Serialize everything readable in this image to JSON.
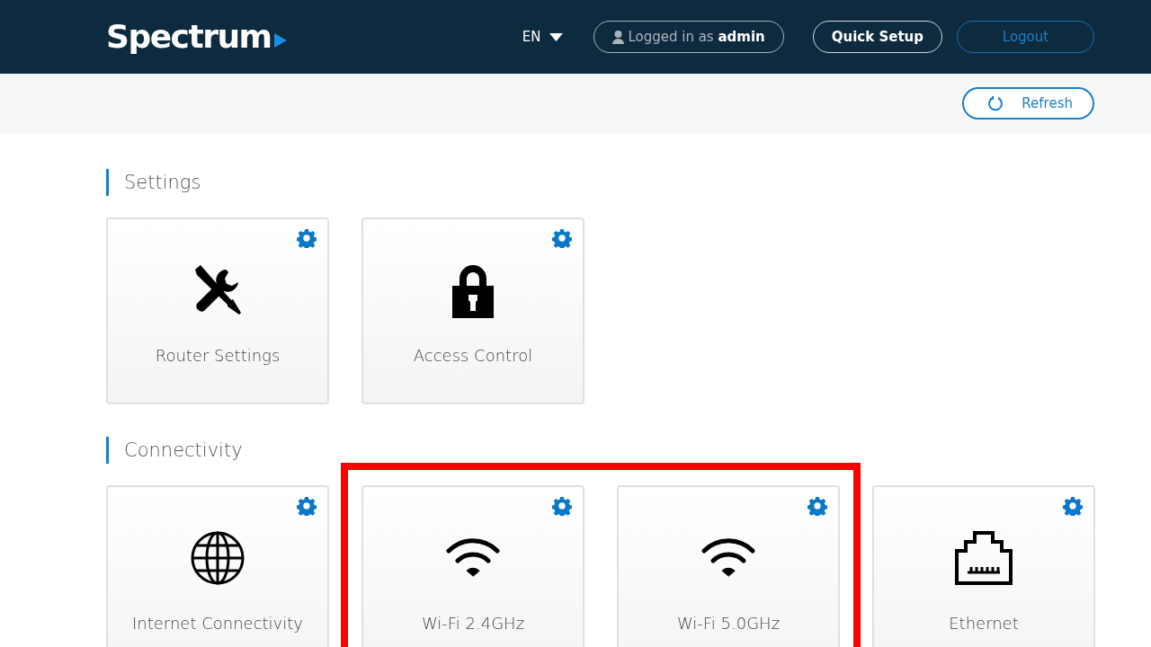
{
  "header": {
    "logo": "Spectrum",
    "language": "EN",
    "user": {
      "prefix": "Logged in as",
      "name": "admin"
    },
    "buttons": [
      {
        "label": "Quick Setup",
        "kind": "outline-white"
      },
      {
        "label": "Logout",
        "kind": "outline-blue"
      }
    ]
  },
  "toolbar": {
    "refresh": "Refresh"
  },
  "sections": [
    {
      "title": "Settings",
      "tiles": [
        {
          "label": "Router Settings",
          "kind": "tools",
          "highlighted": false
        },
        {
          "label": "Access Control",
          "kind": "lock",
          "highlighted": false
        }
      ]
    },
    {
      "title": "Connectivity",
      "tiles": [
        {
          "label": "Internet Connectivity",
          "kind": "globe",
          "highlighted": false
        },
        {
          "label": "Wi-Fi 2.4GHz",
          "kind": "wifi",
          "highlighted": true
        },
        {
          "label": "Wi-Fi 5.0GHz",
          "kind": "wifi",
          "highlighted": true
        },
        {
          "label": "Ethernet",
          "kind": "ethernet",
          "highlighted": false
        }
      ]
    }
  ]
}
